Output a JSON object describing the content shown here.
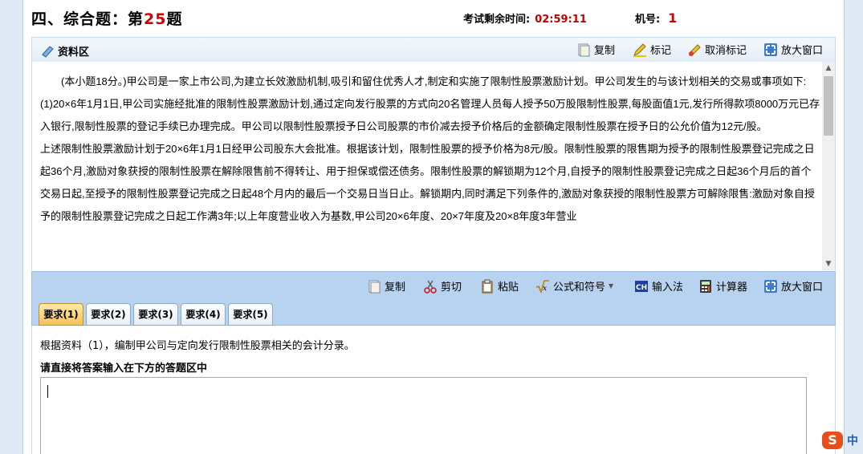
{
  "header": {
    "question_title_prefix": "四、综合题：第",
    "question_number": "25",
    "question_title_suffix": "题",
    "timer_label": "考试剩余时间:",
    "timer_value": "02:59:11",
    "seat_label": "机号:",
    "seat_value": "1"
  },
  "material": {
    "label": "资料区",
    "toolbar": {
      "copy": "复制",
      "mark": "标记",
      "unmark": "取消标记",
      "enlarge": "放大窗口"
    },
    "paragraphs": [
      "(本小题18分。)甲公司是一家上市公司,为建立长效激励机制,吸引和留住优秀人才,制定和实施了限制性股票激励计划。甲公司发生的与该计划相关的交易或事项如下:",
      "(1)20×6年1月1日,甲公司实施经批准的限制性股票激励计划,通过定向发行股票的方式向20名管理人员每人授予50万股限制性股票,每股面值1元,发行所得款项8000万元已存入银行,限制性股票的登记手续已办理完成。甲公司以限制性股票授予日公司股票的市价减去授予价格后的金额确定限制性股票在授予日的公允价值为12元/股。",
      "上述限制性股票激励计划于20×6年1月1日经甲公司股东大会批准。根据该计划，限制性股票的授予价格为8元/股。限制性股票的限售期为授予的限制性股票登记完成之日起36个月,激励对象获授的限制性股票在解除限售前不得转让、用于担保或偿还债务。限制性股票的解锁期为12个月,自授予的限制性股票登记完成之日起36个月后的首个交易日起,至授予的限制性股票登记完成之日起48个月内的最后一个交易日当日止。解锁期内,同时满足下列条件的,激励对象获授的限制性股票方可解除限售:激励对象自授予的限制性股票登记完成之日起工作满3年;以上年度营业收入为基数,甲公司20×6年度、20×7年度及20×8年度3年营业"
    ]
  },
  "answer_toolbar": {
    "copy": "复制",
    "cut": "剪切",
    "paste": "粘贴",
    "formula": "公式和符号",
    "input_method": "输入法",
    "calculator": "计算器",
    "enlarge": "放大窗口"
  },
  "tabs": [
    "要求(1)",
    "要求(2)",
    "要求(3)",
    "要求(4)",
    "要求(5)"
  ],
  "answer": {
    "requirement": "根据资料（1），编制甲公司与定向发行限制性股票相关的会计分录。",
    "hint": "请直接将答案输入在下方的答题区中",
    "value": ""
  },
  "ime": {
    "mode": "中"
  },
  "icons": {
    "copy": "copy-icon",
    "mark": "pencil-icon",
    "unmark": "eraser-icon",
    "enlarge": "expand-icon",
    "cut": "scissors-icon",
    "paste": "clipboard-icon",
    "formula": "sqrt-icon",
    "input_method": "ch-icon",
    "calculator": "calculator-icon",
    "material": "book-icon"
  }
}
